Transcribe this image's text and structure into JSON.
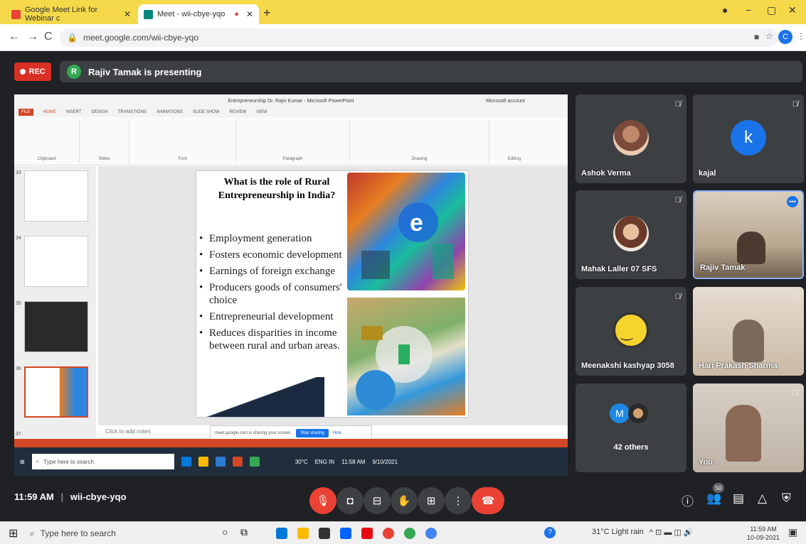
{
  "browser": {
    "tabs": [
      {
        "title": "Google Meet Link for Webinar c"
      },
      {
        "title": "Meet - wii-cbye-yqo"
      }
    ],
    "url": "meet.google.com/wii-cbye-yqo",
    "profile_initial": "C"
  },
  "meet": {
    "rec_label": "REC",
    "presenter_initial": "R",
    "presenting_text": "Rajiv Tamak is presenting",
    "time": "11:59 AM",
    "meeting_code": "wii-cbye-yqo",
    "participant_count": "50"
  },
  "presentation": {
    "window_title": "Entrepreneurship Dr. Rajiv Kumar - Microsoft PowerPoint",
    "ribbon_tabs": [
      "FILE",
      "HOME",
      "INSERT",
      "DESIGN",
      "TRANSITIONS",
      "ANIMATIONS",
      "SLIDE SHOW",
      "REVIEW",
      "VIEW"
    ],
    "ribbon_groups": [
      "Clipboard",
      "Slides",
      "Font",
      "Paragraph",
      "Drawing",
      "Editing"
    ],
    "account": "Microsoft account",
    "thumb_numbers": [
      "33",
      "34",
      "35",
      "36",
      "37"
    ],
    "slide_title": "What is the role of Rural Entrepreneurship in India?",
    "bullets": [
      "Employment generation",
      "Fosters economic development",
      "Earnings of foreign exchange",
      "Producers goods of consumers' choice",
      "Entrepreneurial development",
      "Reduces disparities in income between rural and urban areas."
    ],
    "notes_placeholder": "Click to add notes",
    "share_text": "meet.google.com is sharing your screen.",
    "stop_sharing": "Stop sharing",
    "hide": "Hide",
    "inner_search": "Type here to search",
    "inner_temp": "30°C",
    "inner_time": "11:58 AM",
    "inner_date": "9/10/2021",
    "inner_lang": "ENG IN"
  },
  "participants": [
    {
      "name": "Ashok Verma"
    },
    {
      "name": "kajal",
      "initial": "k"
    },
    {
      "name": "Mahak Laller 07 SFS"
    },
    {
      "name": "Rajiv Tamak"
    },
    {
      "name": "Meenakshi kashyap 3058"
    },
    {
      "name": "Hari Prakash Sharma"
    },
    {
      "name": "42 others",
      "initial": "M"
    },
    {
      "name": "You"
    }
  ],
  "taskbar": {
    "search_placeholder": "Type here to search",
    "weather": "31°C Light rain",
    "time": "11:59 AM",
    "date": "10-09-2021"
  }
}
